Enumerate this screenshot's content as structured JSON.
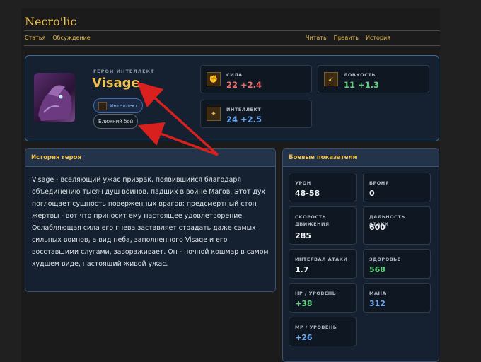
{
  "site": {
    "title": "Necro'lic"
  },
  "nav_left": [
    "Статья",
    "Обсуждение"
  ],
  "nav_right": [
    "Читать",
    "Править",
    "История"
  ],
  "hero": {
    "label": "ГЕРОЙ ИНТЕЛЛЕКТ",
    "name": "Visage",
    "tags": [
      "Интеллект",
      "Ближний бой"
    ]
  },
  "attributes": [
    {
      "name": "СИЛА",
      "value": "22 +2.4",
      "color": "#ef6b6b",
      "icon": "strength-icon"
    },
    {
      "name": "ЛОВКОСТЬ",
      "value": "11 +1.3",
      "color": "#5fd07a",
      "icon": "agility-icon"
    },
    {
      "name": "ИНТЕЛЛЕКТ",
      "value": "24 +2.5",
      "color": "#6aa7f0",
      "icon": "intelligence-icon"
    }
  ],
  "story": {
    "title": "История героя",
    "text": "Visage - вселяющий ужас призрак, появившийся благодаря объединению тысяч душ воинов, падших в войне Магов. Этот дух поглощает сущность поверженных врагов; предсмертный стон жертвы - вот что приносит ему настоящее удовлетворение. Ослабляющая сила его гнева заставляет страдать даже самых сильных воинов, а вид неба, заполненного Visage и его восставшими слугами, завораживает. Он - ночной кошмар в самом худшем виде, настоящий живой ужас."
  },
  "combat": {
    "title": "Боевые показатели",
    "stats": [
      {
        "label": "УРОН",
        "value": "48-58",
        "color": "#f2f4f6"
      },
      {
        "label": "БРОНЯ",
        "value": "0",
        "color": "#f2f4f6"
      },
      {
        "label": "СКОРОСТЬ ДВИЖЕНИЯ",
        "value": "285",
        "color": "#f2f4f6"
      },
      {
        "label": "ДАЛЬНОСТЬ АТАКИ",
        "value": "600",
        "color": "#f2f4f6"
      },
      {
        "label": "ИНТЕРВАЛ АТАКИ",
        "value": "1.7",
        "color": "#f2f4f6"
      },
      {
        "label": "ЗДОРОВЬЕ",
        "value": "568",
        "color": "#5fd07a"
      },
      {
        "label": "HP / УРОВЕНЬ",
        "value": "+38",
        "color": "#5fd07a"
      },
      {
        "label": "МАНА",
        "value": "312",
        "color": "#6aa7f0"
      },
      {
        "label": "MP / УРОВЕНЬ",
        "value": "+26",
        "color": "#6aa7f0"
      }
    ]
  }
}
